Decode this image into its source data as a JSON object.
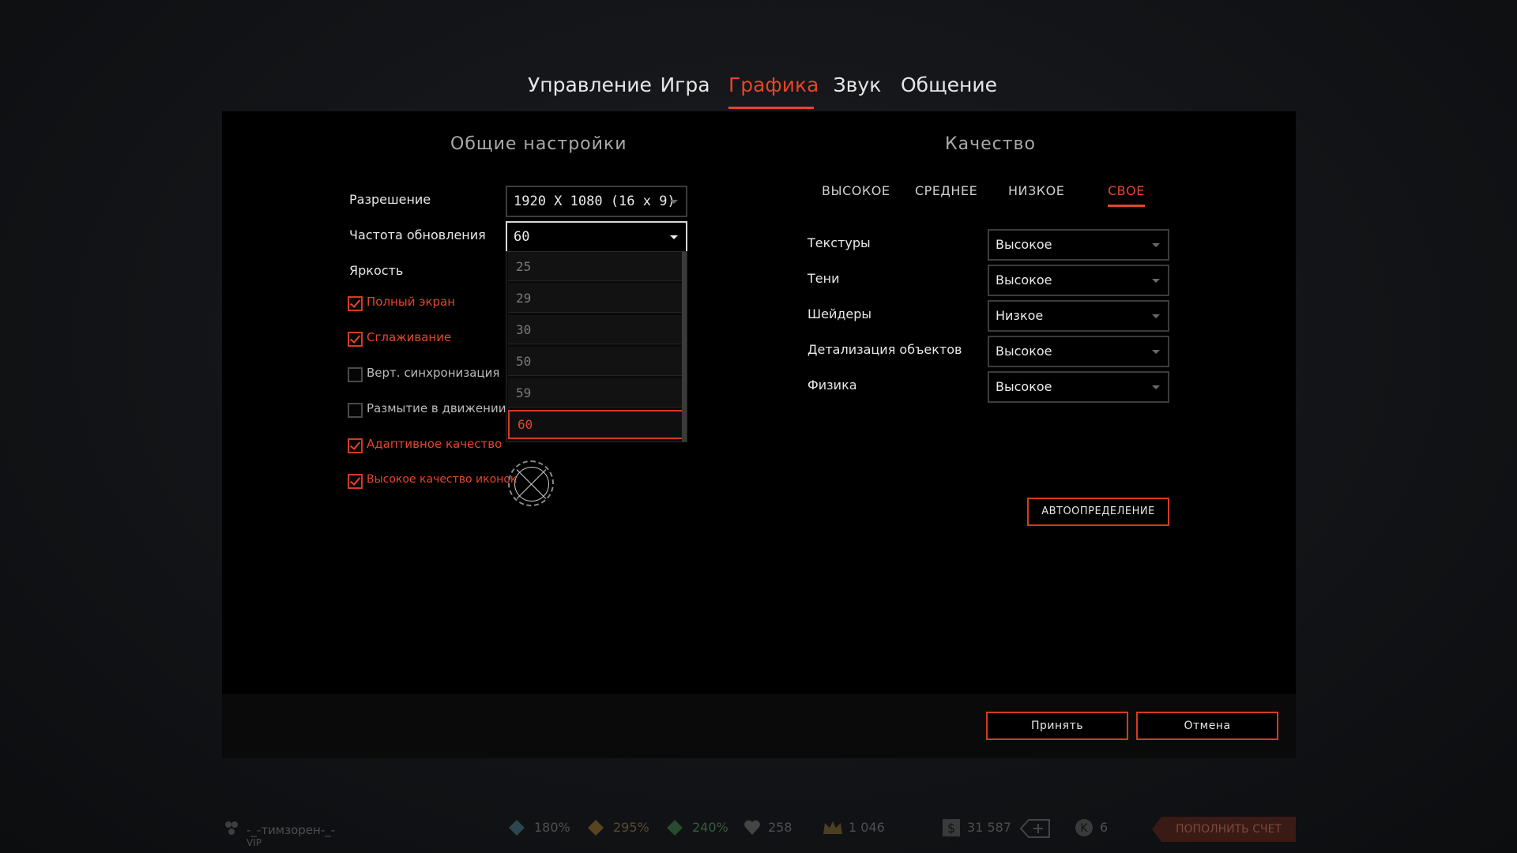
{
  "tabs": [
    {
      "label": "Управление",
      "active": false
    },
    {
      "label": "Игра",
      "active": false
    },
    {
      "label": "Графика",
      "active": true
    },
    {
      "label": "Звук",
      "active": false
    },
    {
      "label": "Общение",
      "active": false
    }
  ],
  "general": {
    "title": "Общие настройки",
    "resolution_label": "Разрешение",
    "resolution_value": "1920 X 1080 (16 x 9)",
    "refresh_label": "Частота обновления",
    "refresh_value": "60",
    "brightness_label": "Яркость",
    "refresh_options": [
      "25",
      "29",
      "30",
      "50",
      "59",
      "60"
    ],
    "refresh_selected": "60",
    "checkboxes": [
      {
        "label": "Полный экран",
        "checked": true
      },
      {
        "label": "Сглаживание",
        "checked": true
      },
      {
        "label": "Верт. синхронизация",
        "checked": false
      },
      {
        "label": "Размытие в движении",
        "checked": false
      },
      {
        "label": "Адаптивное качество",
        "checked": true
      },
      {
        "label": "Высокое качество иконок",
        "checked": true
      }
    ]
  },
  "quality": {
    "title": "Качество",
    "presets": [
      {
        "label": "ВЫСОКОЕ",
        "active": false
      },
      {
        "label": "СРЕДНЕЕ",
        "active": false
      },
      {
        "label": "НИЗКОЕ",
        "active": false
      },
      {
        "label": "СВОЕ",
        "active": true
      }
    ],
    "rows": [
      {
        "label": "Текстуры",
        "value": "Высокое"
      },
      {
        "label": "Тени",
        "value": "Высокое"
      },
      {
        "label": "Шейдеры",
        "value": "Низкое"
      },
      {
        "label": "Детализация объектов",
        "value": "Высокое"
      },
      {
        "label": "Физика",
        "value": "Высокое"
      }
    ],
    "autodetect_label": "АВТООПРЕДЕЛЕНИЕ"
  },
  "footer": {
    "accept_label": "Принять",
    "cancel_label": "Отмена"
  },
  "statusbar": {
    "username": "-_-тимзорен-_-",
    "rank": "VIP",
    "stat1": "180%",
    "stat2": "295%",
    "stat3": "240%",
    "stat4": "258",
    "stat5": "1 046",
    "money": "31 587",
    "kredits": "6",
    "topup_label": "ПОПОЛНИТЬ СЧЕТ"
  },
  "colors": {
    "accent": "#e5452c",
    "panel": "#000000",
    "background": "#15171a"
  }
}
